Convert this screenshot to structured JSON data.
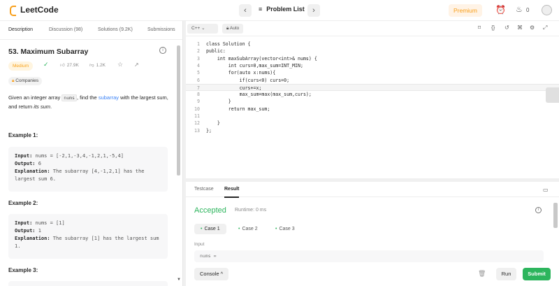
{
  "topbar": {
    "brand": "LeetCode",
    "problem_list": "Problem List",
    "prev_icon": "chevron-left-icon",
    "next_icon": "chevron-right-icon",
    "premium": "Premium",
    "streak_count": "0"
  },
  "tabs": [
    {
      "label": "Description"
    },
    {
      "label": "Discussion (98)"
    },
    {
      "label": "Solutions (9.2K)"
    },
    {
      "label": "Submissions"
    }
  ],
  "problem": {
    "title": "53. Maximum Subarray",
    "difficulty": "Medium",
    "likes": "27.9K",
    "dislikes": "1.2K",
    "companies": "Companies",
    "desc_part1": "Given an integer array ",
    "desc_code": "nums",
    "desc_part2": ", find the ",
    "desc_link": "subarray",
    "desc_part3": " with the largest sum, and return ",
    "desc_em": "its sum",
    "desc_end": "."
  },
  "examples": [
    {
      "title": "Example 1:",
      "input_label": "Input:",
      "input": "nums = [-2,1,-3,4,-1,2,1,-5,4]",
      "output_label": "Output:",
      "output": "6",
      "expl_label": "Explanation:",
      "expl": "The subarray [4,-1,2,1] has the largest sum 6."
    },
    {
      "title": "Example 2:",
      "input_label": "Input:",
      "input": "nums = [1]",
      "output_label": "Output:",
      "output": "1",
      "expl_label": "Explanation:",
      "expl": "The subarray [1] has the largest sum 1."
    },
    {
      "title": "Example 3:"
    }
  ],
  "editor": {
    "language": "C++",
    "auto": "Auto",
    "lines": [
      {
        "n": "1",
        "t": "class Solution {"
      },
      {
        "n": "2",
        "t": "public:"
      },
      {
        "n": "3",
        "t": "    int maxSubArray(vector<int>& nums) {"
      },
      {
        "n": "4",
        "t": "        int curs=0,max_sum=INT_MIN;"
      },
      {
        "n": "5",
        "t": "        for(auto x:nums){"
      },
      {
        "n": "6",
        "t": "            if(curs<0) curs=0;"
      },
      {
        "n": "7",
        "t": "            curs+=x;"
      },
      {
        "n": "8",
        "t": "            max_sum=max(max_sum,curs);"
      },
      {
        "n": "9",
        "t": "        }"
      },
      {
        "n": "10",
        "t": "        return max_sum;"
      },
      {
        "n": "11",
        "t": ""
      },
      {
        "n": "12",
        "t": "    }"
      },
      {
        "n": "13",
        "t": "};"
      }
    ]
  },
  "result": {
    "tab_testcase": "Testcase",
    "tab_result": "Result",
    "status": "Accepted",
    "runtime": "Runtime: 0 ms",
    "cases": [
      "Case 1",
      "Case 2",
      "Case 3"
    ],
    "input_label": "Input",
    "input_value": "nums =",
    "console": "Console",
    "run": "Run",
    "submit": "Submit",
    "accent": "#2db55d"
  }
}
